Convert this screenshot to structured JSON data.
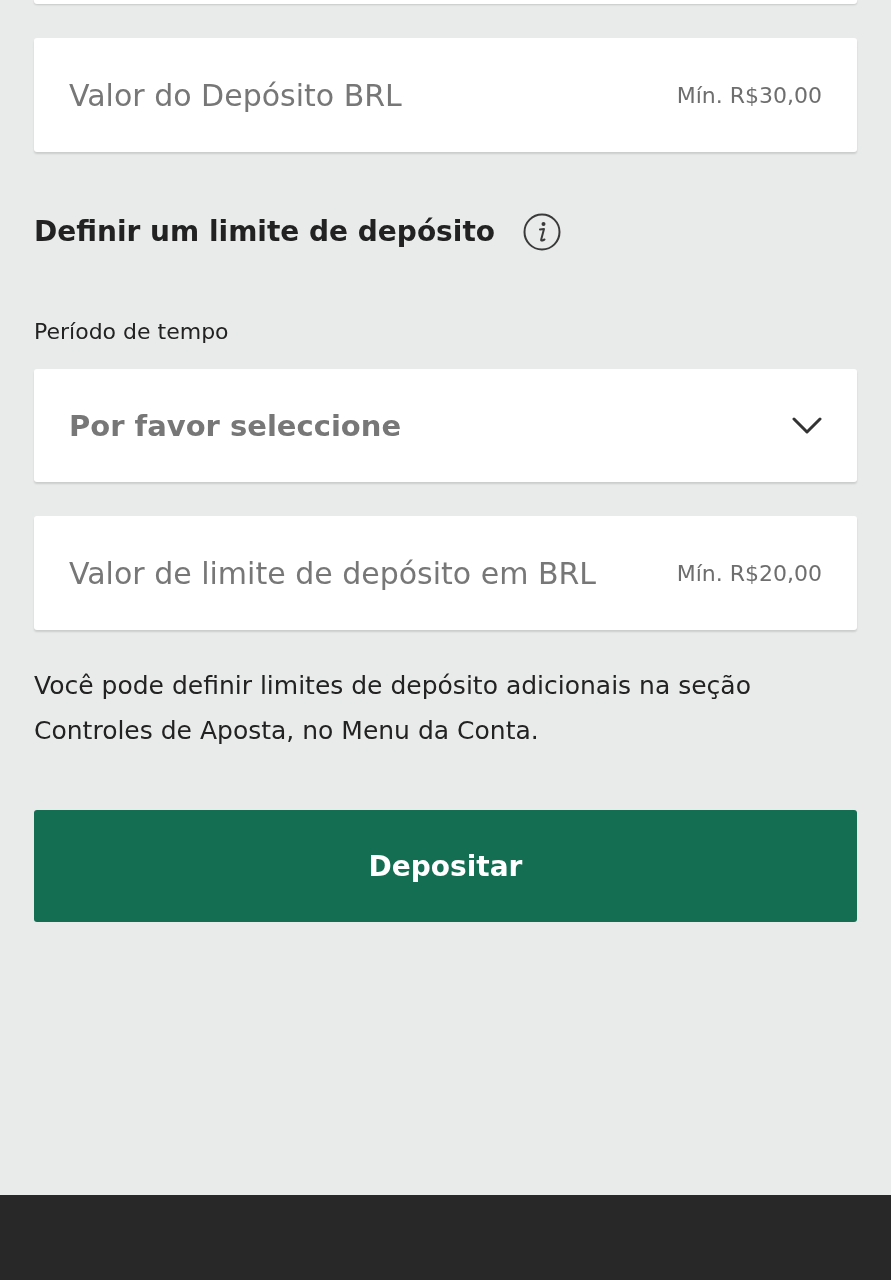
{
  "deposit_amount": {
    "placeholder": "Valor do Depósito BRL",
    "minimum": "Mín. R$30,00"
  },
  "deposit_limit": {
    "title": "Definir um limite de depósito",
    "time_period": {
      "label": "Período de tempo",
      "placeholder": "Por favor seleccione"
    },
    "limit_amount": {
      "placeholder": "Valor de limite de depósito em BRL",
      "minimum": "Mín. R$20,00"
    },
    "note": "Você pode definir limites de depósito adicionais na seção Controles de Aposta, no Menu da Conta."
  },
  "submit_button": {
    "label": "Depositar"
  }
}
